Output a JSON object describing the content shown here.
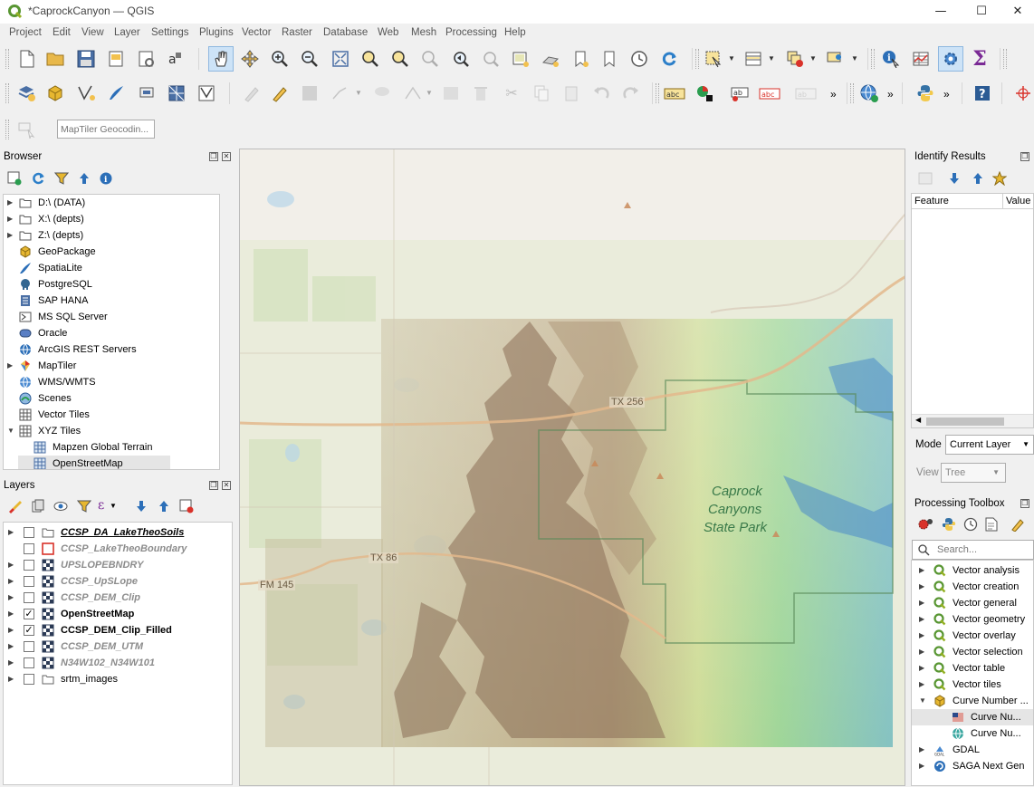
{
  "window": {
    "title": "*CaprockCanyon — QGIS",
    "minimize": "—",
    "maximize": "☐",
    "close": "✕"
  },
  "menu": [
    "Project",
    "Edit",
    "View",
    "Layer",
    "Settings",
    "Plugins",
    "Vector",
    "Raster",
    "Database",
    "Web",
    "Mesh",
    "Processing",
    "Help"
  ],
  "geocoder": {
    "placeholder": "MapTiler Geocodin..."
  },
  "browser": {
    "title": "Browser",
    "items": [
      {
        "label": "D:\\ (DATA)",
        "icon": "folder-icon"
      },
      {
        "label": "X:\\ (depts)",
        "icon": "folder-icon"
      },
      {
        "label": "Z:\\ (depts)",
        "icon": "folder-icon"
      },
      {
        "label": "GeoPackage",
        "icon": "geopackage-icon"
      },
      {
        "label": "SpatiaLite",
        "icon": "spatialite-icon"
      },
      {
        "label": "PostgreSQL",
        "icon": "postgresql-icon"
      },
      {
        "label": "SAP HANA",
        "icon": "sap-hana-icon"
      },
      {
        "label": "MS SQL Server",
        "icon": "mssql-icon"
      },
      {
        "label": "Oracle",
        "icon": "oracle-icon"
      },
      {
        "label": "ArcGIS REST Servers",
        "icon": "arcgis-icon"
      },
      {
        "label": "MapTiler",
        "icon": "maptiler-icon"
      },
      {
        "label": "WMS/WMTS",
        "icon": "wms-icon"
      },
      {
        "label": "Scenes",
        "icon": "scenes-icon"
      },
      {
        "label": "Vector Tiles",
        "icon": "vector-tiles-icon"
      },
      {
        "label": "XYZ Tiles",
        "icon": "xyz-tiles-icon"
      },
      {
        "label": "Mapzen Global Terrain",
        "icon": "xyz-layer-icon"
      },
      {
        "label": "OpenStreetMap",
        "icon": "xyz-layer-icon"
      }
    ]
  },
  "layers": {
    "title": "Layers",
    "items": [
      {
        "label": "CCSP_DA_LakeTheoSoils",
        "checked": false,
        "icon": "group-icon"
      },
      {
        "label": "CCSP_LakeTheoBoundary",
        "checked": false,
        "icon": "polygon-layer-icon"
      },
      {
        "label": "UPSLOPEBNDRY",
        "checked": false,
        "icon": "raster-layer-icon"
      },
      {
        "label": "CCSP_UpSLope",
        "checked": false,
        "icon": "raster-layer-icon"
      },
      {
        "label": "CCSP_DEM_Clip",
        "checked": false,
        "icon": "raster-layer-icon"
      },
      {
        "label": "OpenStreetMap",
        "checked": true,
        "icon": "raster-layer-icon"
      },
      {
        "label": "CCSP_DEM_Clip_Filled",
        "checked": true,
        "icon": "raster-layer-icon"
      },
      {
        "label": "CCSP_DEM_UTM",
        "checked": false,
        "icon": "raster-layer-icon"
      },
      {
        "label": "N34W102_N34W101",
        "checked": false,
        "icon": "raster-layer-icon"
      },
      {
        "label": "srtm_images",
        "checked": false,
        "icon": "group-icon"
      }
    ]
  },
  "map": {
    "labels": {
      "tx256": "TX 256",
      "tx86": "TX 86",
      "fm145": "FM 145",
      "park1": "Caprock",
      "park2": "Canyons",
      "park3": "State Park"
    }
  },
  "identify": {
    "title": "Identify Results",
    "col_feature": "Feature",
    "col_value": "Value",
    "mode_label": "Mode",
    "mode_value": "Current Layer",
    "view_label": "View",
    "view_value": "Tree"
  },
  "processing": {
    "title": "Processing Toolbox",
    "search_placeholder": "Search...",
    "items": [
      {
        "label": "Vector analysis",
        "icon": "qgis-provider-icon"
      },
      {
        "label": "Vector creation",
        "icon": "qgis-provider-icon"
      },
      {
        "label": "Vector general",
        "icon": "qgis-provider-icon"
      },
      {
        "label": "Vector geometry",
        "icon": "qgis-provider-icon"
      },
      {
        "label": "Vector overlay",
        "icon": "qgis-provider-icon"
      },
      {
        "label": "Vector selection",
        "icon": "qgis-provider-icon"
      },
      {
        "label": "Vector table",
        "icon": "qgis-provider-icon"
      },
      {
        "label": "Vector tiles",
        "icon": "qgis-provider-icon"
      },
      {
        "label": "Curve Number ...",
        "icon": "curve-number-provider-icon"
      },
      {
        "label": "Curve Nu...",
        "icon": "us-flag-icon"
      },
      {
        "label": "Curve Nu...",
        "icon": "globe-icon"
      },
      {
        "label": "GDAL",
        "icon": "gdal-icon"
      },
      {
        "label": "SAGA Next Gen",
        "icon": "saga-icon"
      }
    ]
  }
}
